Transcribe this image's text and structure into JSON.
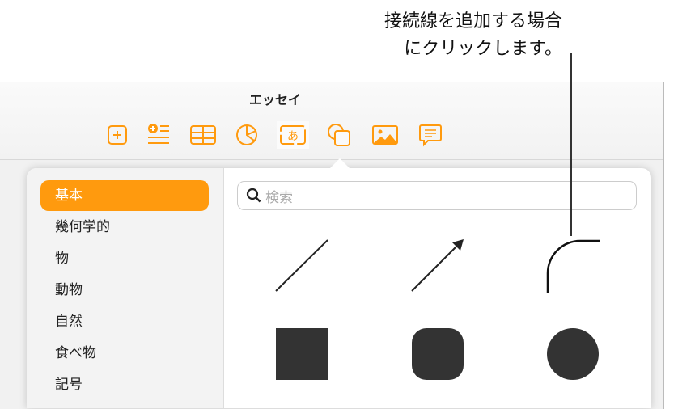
{
  "callout": {
    "line1": "接続線を追加する場合",
    "line2": "にクリックします。"
  },
  "window": {
    "title": "エッセイ"
  },
  "toolbar": {
    "items": [
      "insert-icon",
      "text-list-icon",
      "table-icon",
      "chart-icon",
      "text-box-icon",
      "shape-icon",
      "media-icon",
      "comment-icon"
    ],
    "textbox_glyph": "あ",
    "accent": "#ff9a0e"
  },
  "sidebar": {
    "items": [
      "基本",
      "幾何学的",
      "物",
      "動物",
      "自然",
      "食べ物",
      "記号"
    ],
    "selected": 0
  },
  "search": {
    "placeholder": "検索"
  },
  "shapes": [
    "line",
    "arrow",
    "curved-connection-line",
    "square",
    "rounded-square",
    "circle"
  ]
}
